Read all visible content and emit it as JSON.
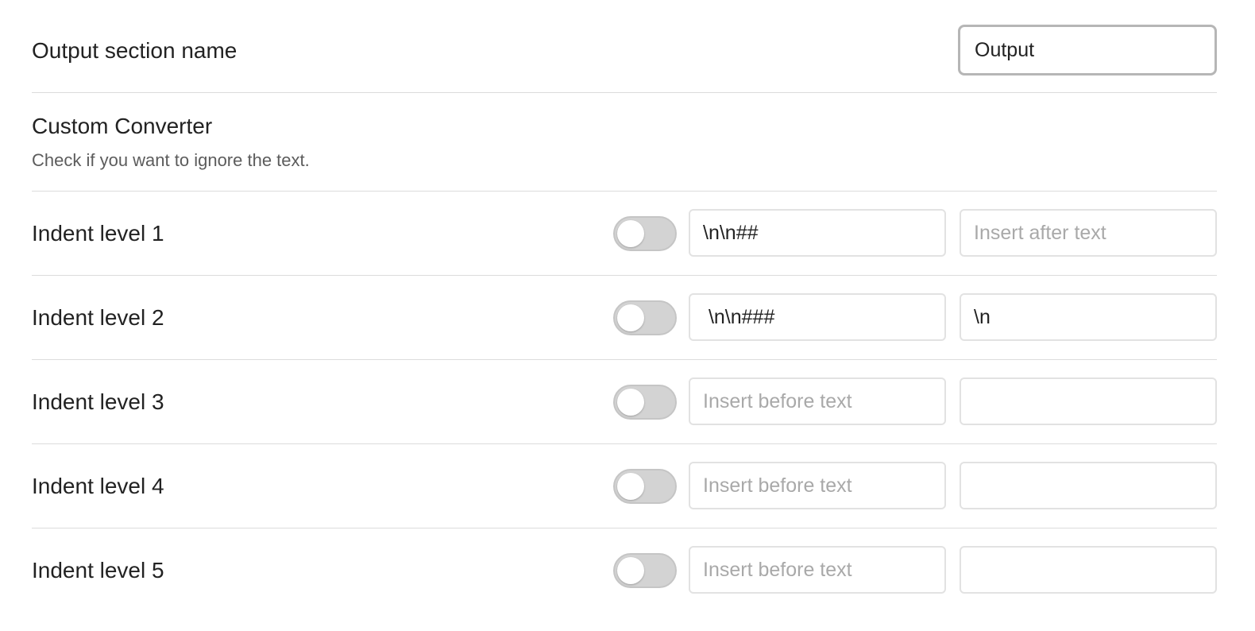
{
  "output_section": {
    "label": "Output section name",
    "value": "Output"
  },
  "custom_converter": {
    "title": "Custom Converter",
    "description": "Check if you want to ignore the text."
  },
  "indent_levels": [
    {
      "label": "Indent level 1",
      "enabled": false,
      "before_value": "\\n\\n##",
      "before_placeholder": "",
      "after_value": "",
      "after_placeholder": "Insert after text"
    },
    {
      "label": "Indent level 2",
      "enabled": false,
      "before_value": " \\n\\n###",
      "before_placeholder": "",
      "after_value": "\\n",
      "after_placeholder": ""
    },
    {
      "label": "Indent level 3",
      "enabled": false,
      "before_value": "",
      "before_placeholder": "Insert before text",
      "after_value": "",
      "after_placeholder": ""
    },
    {
      "label": "Indent level 4",
      "enabled": false,
      "before_value": "",
      "before_placeholder": "Insert before text",
      "after_value": "",
      "after_placeholder": ""
    },
    {
      "label": "Indent level 5",
      "enabled": false,
      "before_value": "",
      "before_placeholder": "Insert before text",
      "after_value": "",
      "after_placeholder": ""
    }
  ]
}
